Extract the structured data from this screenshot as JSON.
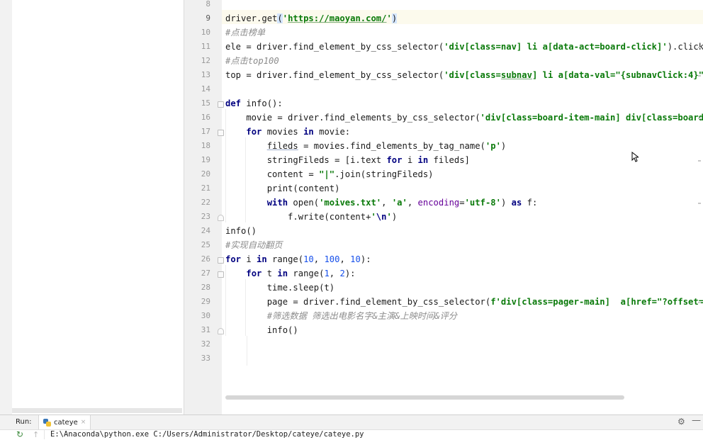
{
  "editor": {
    "line_numbers": [
      "8",
      "9",
      "10",
      "11",
      "12",
      "13",
      "14",
      "15",
      "16",
      "17",
      "18",
      "19",
      "20",
      "21",
      "22",
      "23",
      "24",
      "25",
      "26",
      "27",
      "28",
      "29",
      "30",
      "31",
      "32",
      "33"
    ],
    "current_line": "9"
  },
  "run_panel": {
    "label": "Run:",
    "tab_name": "cateye",
    "close_glyph": "×",
    "command": "E:\\Anaconda\\python.exe C:/Users/Administrator/Desktop/cateye/cateye.py"
  },
  "icons": {
    "settings": "gear-icon",
    "minimize": "minimize-icon",
    "rerun": "rerun-icon",
    "scroll_up": "up-arrow-icon",
    "python_file": "python-file-icon"
  },
  "colors": {
    "keyword": "#000080",
    "string": "#0a7a0a",
    "comment": "#8c8c8c",
    "number": "#1750eb",
    "kwarg": "#660099",
    "current_line_bg": "#fcfaed"
  }
}
